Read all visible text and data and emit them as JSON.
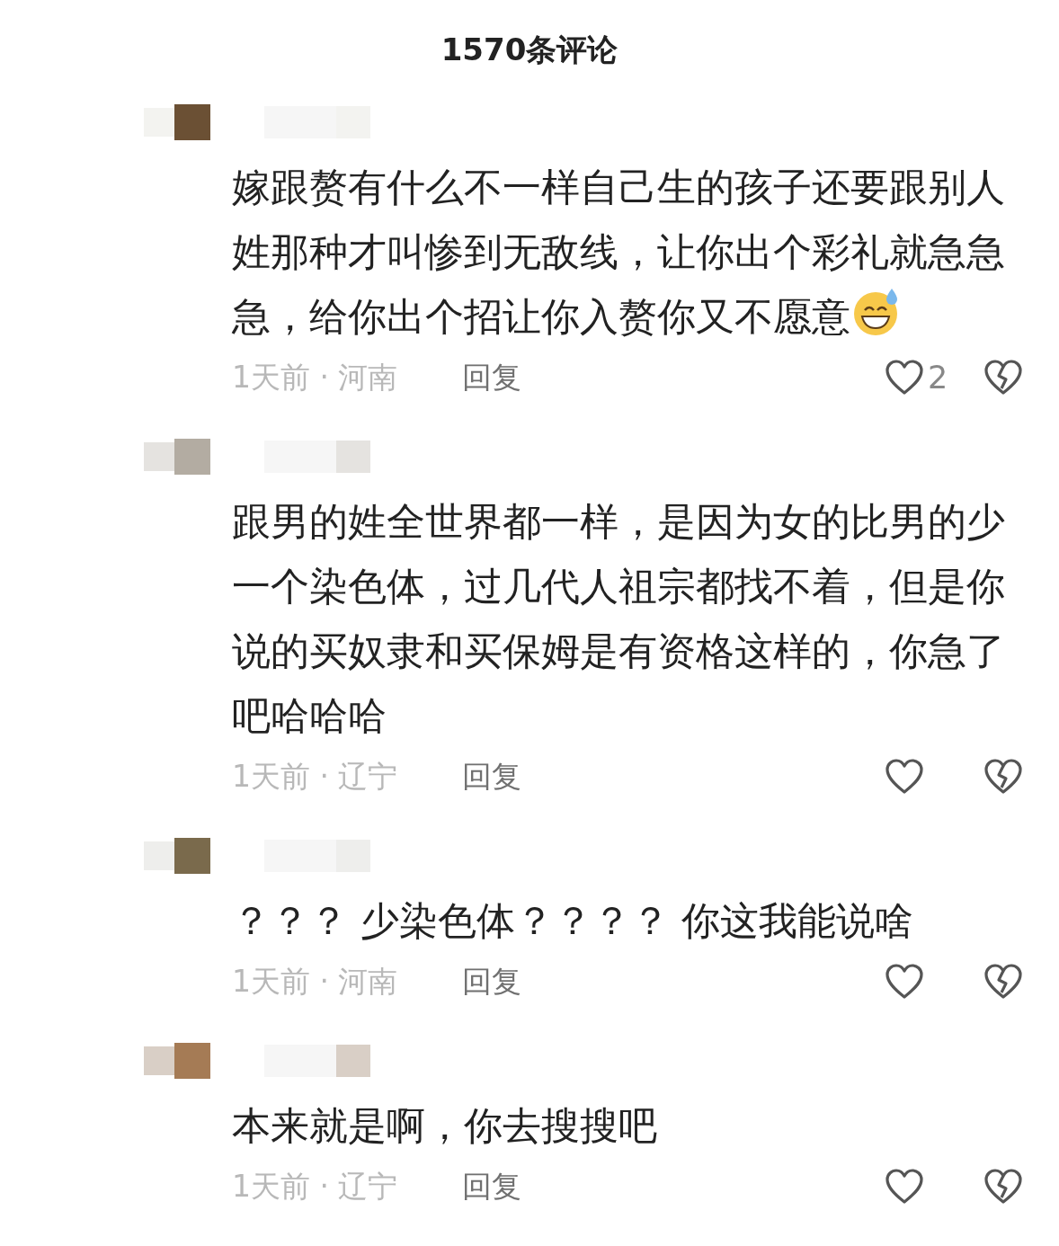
{
  "header": {
    "title": "1570条评论"
  },
  "comments": [
    {
      "text": "嫁跟赘有什么不一样自己生的孩子还要跟别人姓那种才叫惨到无敌线，让你出个彩礼就急急急，给你出个招让你入赘你又不愿意",
      "kind": "with-emoji",
      "meta": "1天前 · 河南",
      "reply": "回复",
      "likes": "2"
    },
    {
      "text": "跟男的姓全世界都一样，是因为女的比男的少一个染色体，过几代人祖宗都找不着，但是你说的买奴隶和买保姆是有资格这样的，你急了吧哈哈哈",
      "kind": "plain",
      "meta": "1天前 · 辽宁",
      "reply": "回复"
    },
    {
      "text": "？？？ 少染色体？？？？ 你这我能说啥",
      "kind": "plain",
      "meta": "1天前 · 河南",
      "reply": "回复"
    },
    {
      "text": "本来就是啊，你去搜搜吧",
      "kind": "plain",
      "meta": "1天前 · 辽宁",
      "reply": "回复"
    }
  ]
}
